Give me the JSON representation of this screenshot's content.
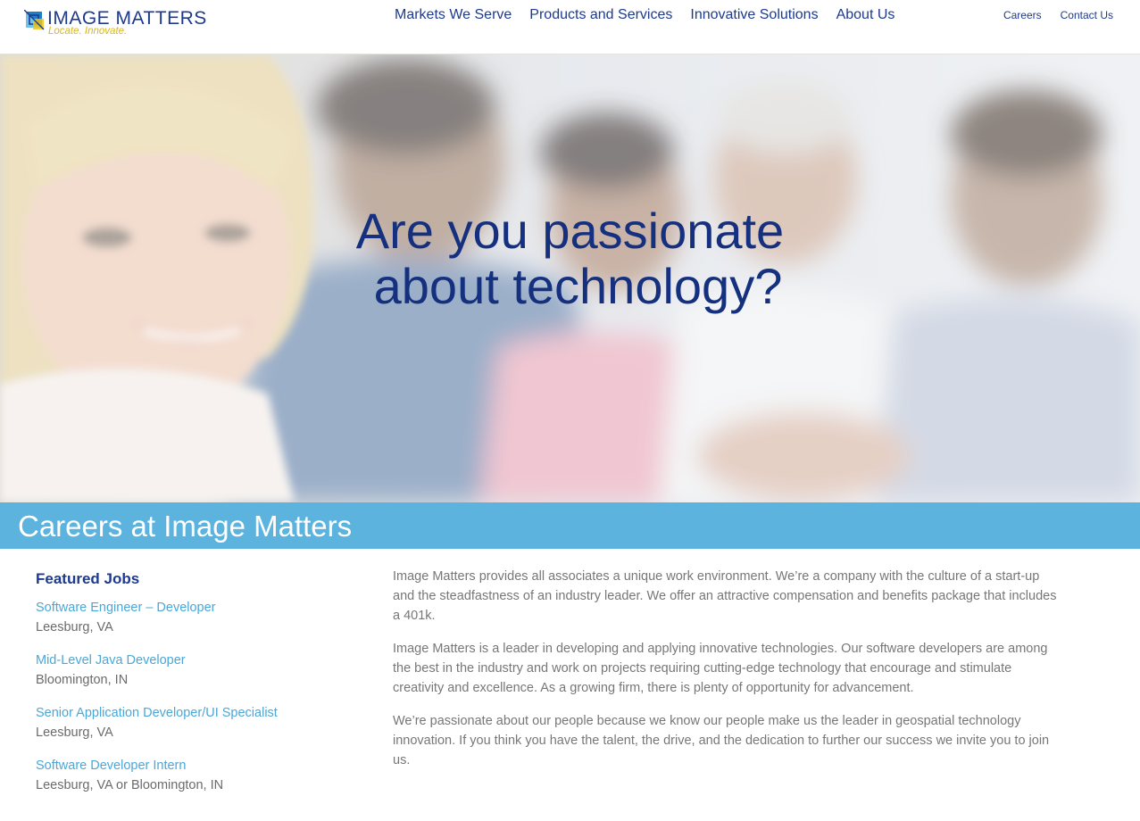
{
  "header": {
    "logo": {
      "name": "IMAGE MATTERS",
      "tagline": "Locate.  Innovate."
    },
    "main_nav": [
      {
        "label": "Markets We Serve"
      },
      {
        "label": "Products and Services"
      },
      {
        "label": "Innovative Solutions"
      },
      {
        "label": "About Us"
      }
    ],
    "utility_nav": [
      {
        "label": "Careers"
      },
      {
        "label": "Contact Us"
      }
    ]
  },
  "hero": {
    "heading_line1": "Are you passionate",
    "heading_line2": "about technology?"
  },
  "careers_band": {
    "title": "Careers at Image Matters"
  },
  "featured_jobs": {
    "heading": "Featured Jobs",
    "jobs": [
      {
        "title": "Software Engineer – Developer",
        "location": "Leesburg, VA"
      },
      {
        "title": "Mid-Level Java Developer",
        "location": "Bloomington, IN"
      },
      {
        "title": "Senior Application Developer/UI Specialist",
        "location": "Leesburg, VA"
      },
      {
        "title": "Software Developer Intern",
        "location": "Leesburg, VA or Bloomington, IN"
      }
    ]
  },
  "about": {
    "paragraphs": [
      "Image Matters provides all associates a unique work environment. We’re a company with the culture of a start-up and the steadfastness of an industry leader. We offer an attractive compensation and benefits package that includes a 401k.",
      "Image Matters is a leader in developing and applying innovative technologies. Our software developers are among the best in the industry and work on projects requiring cutting-edge technology that encourage and stimulate creativity and excellence. As a growing firm, there is plenty of opportunity for advancement.",
      "We’re passionate about our people because we know our people make us the leader in geospatial technology innovation. If you think you have the talent, the drive, and the dedication to further our success we invite you to join us."
    ]
  },
  "colors": {
    "brand_navy": "#1d3a8f",
    "hero_text": "#14307e",
    "band_blue": "#5bb3de",
    "link_blue": "#4aa7d8",
    "tagline_gold": "#d7b71a",
    "body_gray": "#777777"
  },
  "icons": {
    "logo_mark": "logo-mark-icon"
  }
}
